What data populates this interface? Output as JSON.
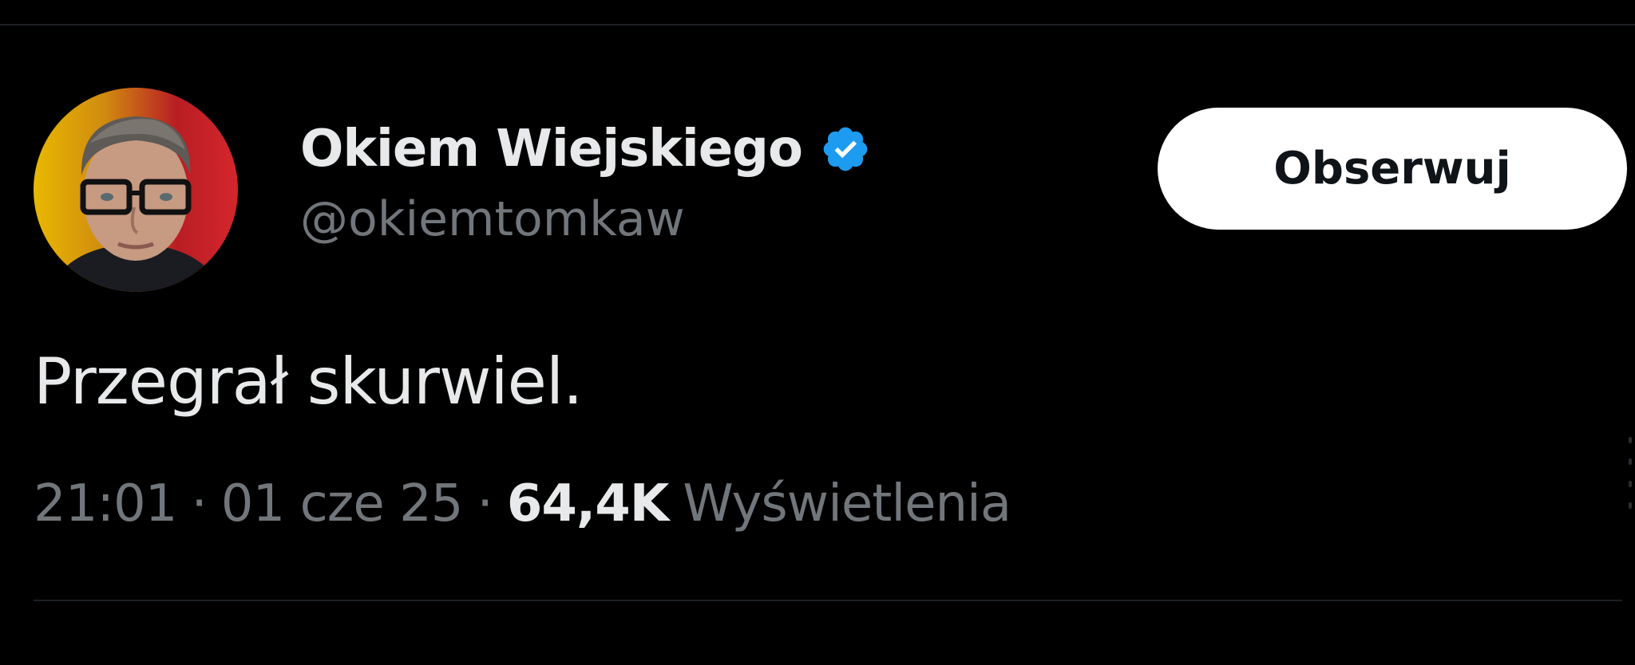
{
  "tweet": {
    "author": {
      "display_name": "Okiem Wiejskiego",
      "handle": "@okiemtomkaw",
      "verified": true,
      "avatar_icon": "profile-photo"
    },
    "follow_label": "Obserwuj",
    "text": "Przegrał skurwiel.",
    "meta": {
      "time": "21:01",
      "date": "01 cze 25",
      "separator": "·",
      "views_count": "64,4K",
      "views_label": "Wyświetlenia"
    }
  },
  "colors": {
    "background": "#000000",
    "primary_text": "#e7e9ea",
    "secondary_text": "#71767b",
    "verified_badge": "#1d9bf0",
    "follow_button_bg": "#ffffff",
    "follow_button_text": "#0f1419",
    "divider": "#1c1f23"
  }
}
